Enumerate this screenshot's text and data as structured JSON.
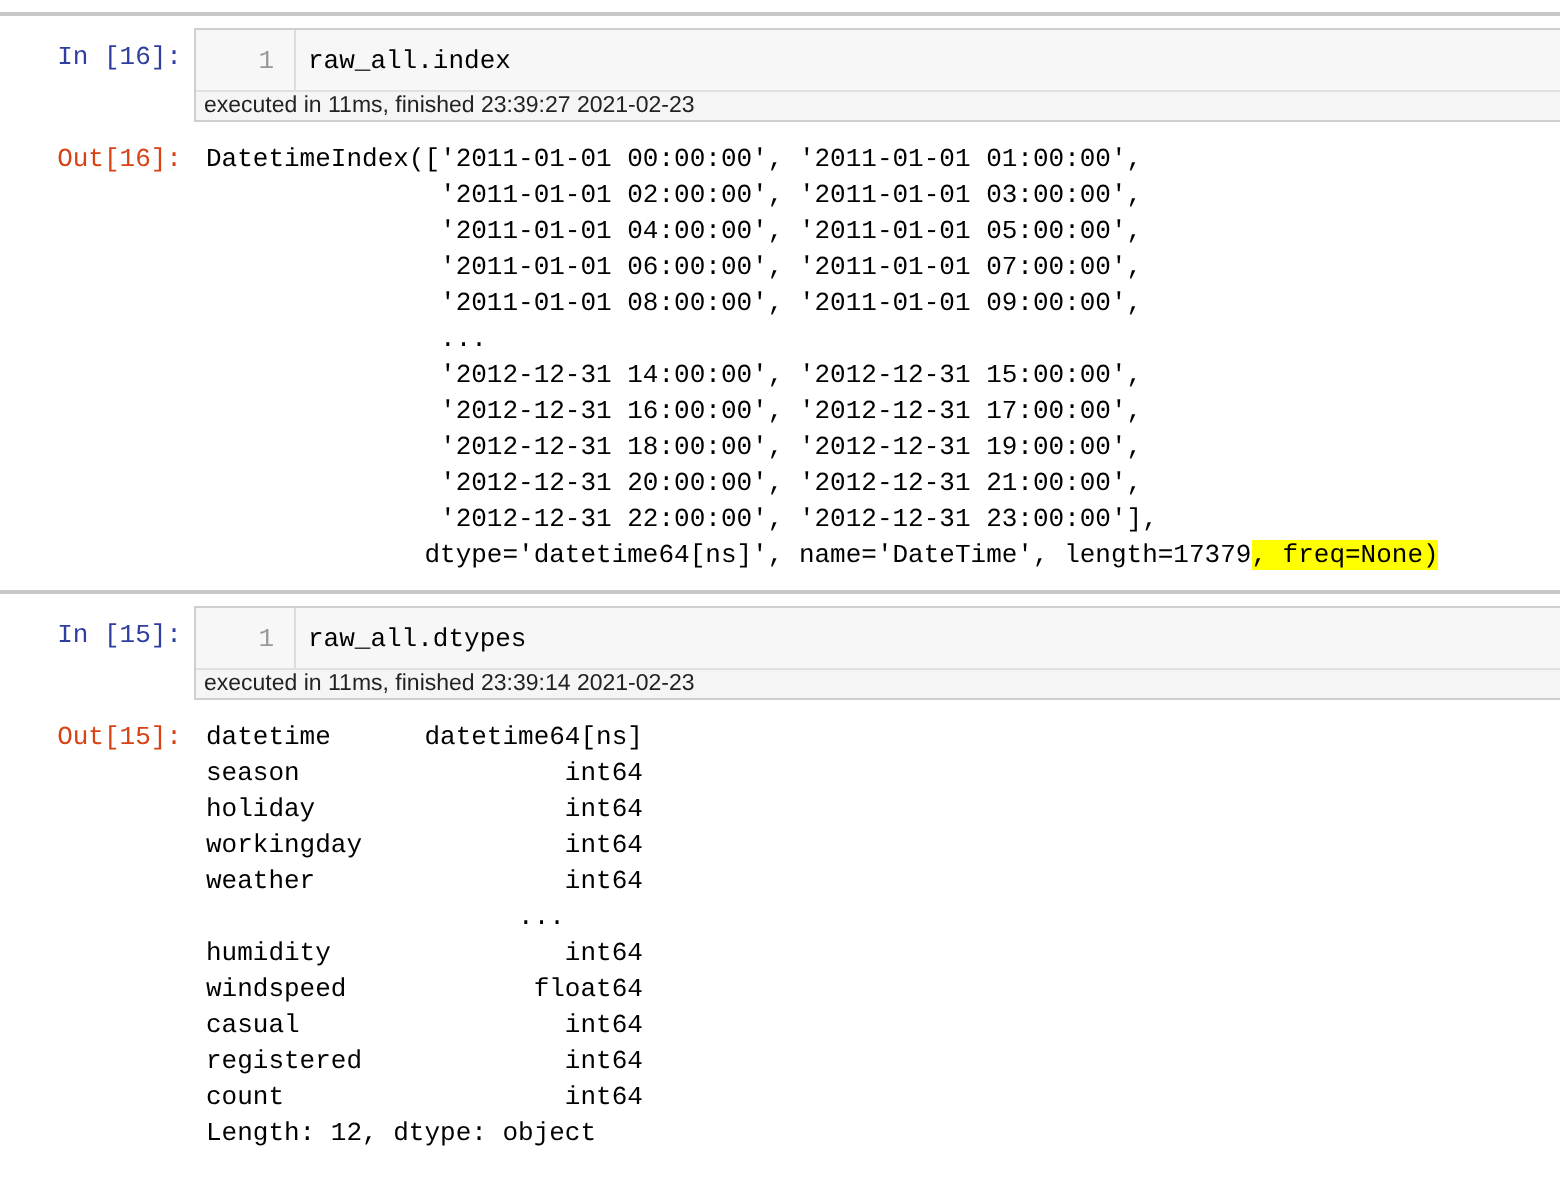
{
  "cells": [
    {
      "in_prompt": "In [16]:",
      "line_number": "1",
      "code": "raw_all.index",
      "exec_info": "executed in 11ms, finished 23:39:27 2021-02-23",
      "out_prompt": "Out[16]:",
      "output_lines": [
        {
          "text": "DatetimeIndex(['2011-01-01 00:00:00', '2011-01-01 01:00:00',"
        },
        {
          "text": "               '2011-01-01 02:00:00', '2011-01-01 03:00:00',"
        },
        {
          "text": "               '2011-01-01 04:00:00', '2011-01-01 05:00:00',"
        },
        {
          "text": "               '2011-01-01 06:00:00', '2011-01-01 07:00:00',"
        },
        {
          "text": "               '2011-01-01 08:00:00', '2011-01-01 09:00:00',"
        },
        {
          "text": "               ..."
        },
        {
          "text": "               '2012-12-31 14:00:00', '2012-12-31 15:00:00',"
        },
        {
          "text": "               '2012-12-31 16:00:00', '2012-12-31 17:00:00',"
        },
        {
          "text": "               '2012-12-31 18:00:00', '2012-12-31 19:00:00',"
        },
        {
          "text": "               '2012-12-31 20:00:00', '2012-12-31 21:00:00',"
        },
        {
          "text": "               '2012-12-31 22:00:00', '2012-12-31 23:00:00'],"
        },
        {
          "text": "              dtype='datetime64[ns]', name='DateTime', length=17379",
          "highlight": ", freq=None)"
        }
      ]
    },
    {
      "in_prompt": "In [15]:",
      "line_number": "1",
      "code": "raw_all.dtypes",
      "exec_info": "executed in 11ms, finished 23:39:14 2021-02-23",
      "out_prompt": "Out[15]:",
      "output_lines": [
        {
          "text": "datetime      datetime64[ns]"
        },
        {
          "text": "season                 int64"
        },
        {
          "text": "holiday                int64"
        },
        {
          "text": "workingday             int64"
        },
        {
          "text": "weather                int64"
        },
        {
          "text": "                    ..."
        },
        {
          "text": "humidity               int64"
        },
        {
          "text": "windspeed            float64"
        },
        {
          "text": "casual                 int64"
        },
        {
          "text": "registered             int64"
        },
        {
          "text": "count                  int64"
        },
        {
          "text": "Length: 12, dtype: object"
        }
      ]
    }
  ]
}
